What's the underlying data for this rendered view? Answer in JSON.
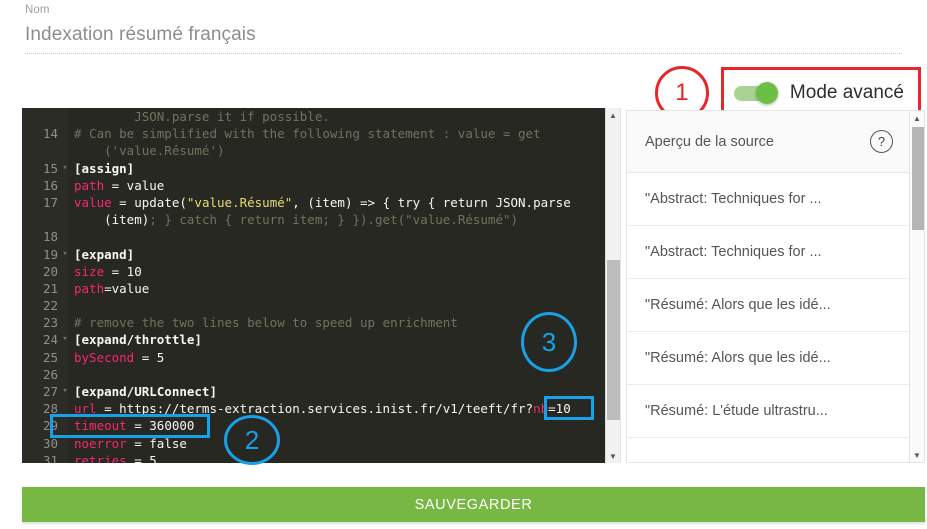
{
  "form": {
    "name_label": "Nom",
    "name_value": "Indexation résumé français"
  },
  "advanced_mode": {
    "annotation_number": "1",
    "label": "Mode avancé",
    "enabled": true,
    "highlight_color": "#e8252a",
    "toggle_on_color": "#6cbf45"
  },
  "editor": {
    "theme_background": "#272822",
    "lines": [
      {
        "number": "",
        "fold": "",
        "tokens": [
          {
            "t": "        JSON.parse it if possible.",
            "c": "tok-comment"
          }
        ]
      },
      {
        "number": "14",
        "fold": "",
        "tokens": [
          {
            "t": "# Can be simplified with the following statement : value = get",
            "c": "tok-comment"
          }
        ]
      },
      {
        "number": "",
        "fold": "",
        "tokens": [
          {
            "t": "    ('value.Résumé')",
            "c": "tok-comment"
          }
        ]
      },
      {
        "number": "15",
        "fold": "▾",
        "tokens": [
          {
            "t": "[assign]",
            "c": "tok-sec"
          }
        ]
      },
      {
        "number": "16",
        "fold": "",
        "tokens": [
          {
            "t": "path",
            "c": "tok-key"
          },
          {
            "t": " = value",
            "c": "tok-plain"
          }
        ]
      },
      {
        "number": "17",
        "fold": "",
        "tokens": [
          {
            "t": "value",
            "c": "tok-key"
          },
          {
            "t": " = update(",
            "c": "tok-plain"
          },
          {
            "t": "\"value.Résumé\"",
            "c": "tok-str"
          },
          {
            "t": ", (item) => { try { return JSON.parse",
            "c": "tok-plain"
          }
        ]
      },
      {
        "number": "",
        "fold": "",
        "tokens": [
          {
            "t": "    (item)",
            "c": "tok-plain"
          },
          {
            "t": "; } catch { return item; } }).get(\"value.Résumé\")",
            "c": "tok-comment"
          }
        ]
      },
      {
        "number": "18",
        "fold": "",
        "tokens": [
          {
            "t": "",
            "c": "tok-plain"
          }
        ]
      },
      {
        "number": "19",
        "fold": "▾",
        "tokens": [
          {
            "t": "[expand]",
            "c": "tok-sec"
          }
        ]
      },
      {
        "number": "20",
        "fold": "",
        "tokens": [
          {
            "t": "size",
            "c": "tok-key"
          },
          {
            "t": " = 10",
            "c": "tok-plain"
          }
        ]
      },
      {
        "number": "21",
        "fold": "",
        "tokens": [
          {
            "t": "path",
            "c": "tok-key"
          },
          {
            "t": "=value",
            "c": "tok-plain"
          }
        ]
      },
      {
        "number": "22",
        "fold": "",
        "tokens": [
          {
            "t": "",
            "c": "tok-plain"
          }
        ]
      },
      {
        "number": "23",
        "fold": "",
        "tokens": [
          {
            "t": "# remove the two lines below to speed up enrichment",
            "c": "tok-comment"
          }
        ]
      },
      {
        "number": "24",
        "fold": "▾",
        "tokens": [
          {
            "t": "[expand/throttle]",
            "c": "tok-sec"
          }
        ]
      },
      {
        "number": "25",
        "fold": "",
        "tokens": [
          {
            "t": "bySecond",
            "c": "tok-key"
          },
          {
            "t": " = 5",
            "c": "tok-plain"
          }
        ]
      },
      {
        "number": "26",
        "fold": "",
        "tokens": [
          {
            "t": "",
            "c": "tok-plain"
          }
        ]
      },
      {
        "number": "27",
        "fold": "▾",
        "tokens": [
          {
            "t": "[expand/URLConnect]",
            "c": "tok-sec"
          }
        ]
      },
      {
        "number": "28",
        "fold": "",
        "tokens": [
          {
            "t": "url",
            "c": "tok-key"
          },
          {
            "t": " = https://terms-extraction.services.inist.fr/v1/teeft/fr?",
            "c": "tok-plain"
          },
          {
            "t": "nb",
            "c": "tok-key"
          },
          {
            "t": "=10",
            "c": "tok-plain"
          }
        ]
      },
      {
        "number": "29",
        "fold": "",
        "tokens": [
          {
            "t": "timeout",
            "c": "tok-key"
          },
          {
            "t": " = 360000",
            "c": "tok-plain"
          }
        ]
      },
      {
        "number": "30",
        "fold": "",
        "tokens": [
          {
            "t": "noerror",
            "c": "tok-key"
          },
          {
            "t": " = false",
            "c": "tok-plain"
          }
        ]
      },
      {
        "number": "31",
        "fold": "",
        "tokens": [
          {
            "t": "retries",
            "c": "tok-key"
          },
          {
            "t": " = 5",
            "c": "tok-plain"
          }
        ]
      }
    ],
    "annotations": {
      "timeout_box_label": "timeout = 360000",
      "nb_box_label": "nb=10",
      "circle_2": "2",
      "circle_3": "3",
      "highlight_color": "#18a0e8"
    }
  },
  "preview": {
    "title": "Aperçu de la source",
    "help_icon_glyph": "?",
    "items": [
      {
        "text": "\"Abstract: Techniques for ..."
      },
      {
        "text": "\"Abstract: Techniques for ..."
      },
      {
        "text": "\"Résumé: Alors que les idé..."
      },
      {
        "text": "\"Résumé: Alors que les idé..."
      },
      {
        "text": "\"Résumé: L'étude ultrastru..."
      },
      {
        "text": ""
      }
    ]
  },
  "footer": {
    "save_label": "SAUVEGARDER",
    "save_color": "#76b843"
  }
}
